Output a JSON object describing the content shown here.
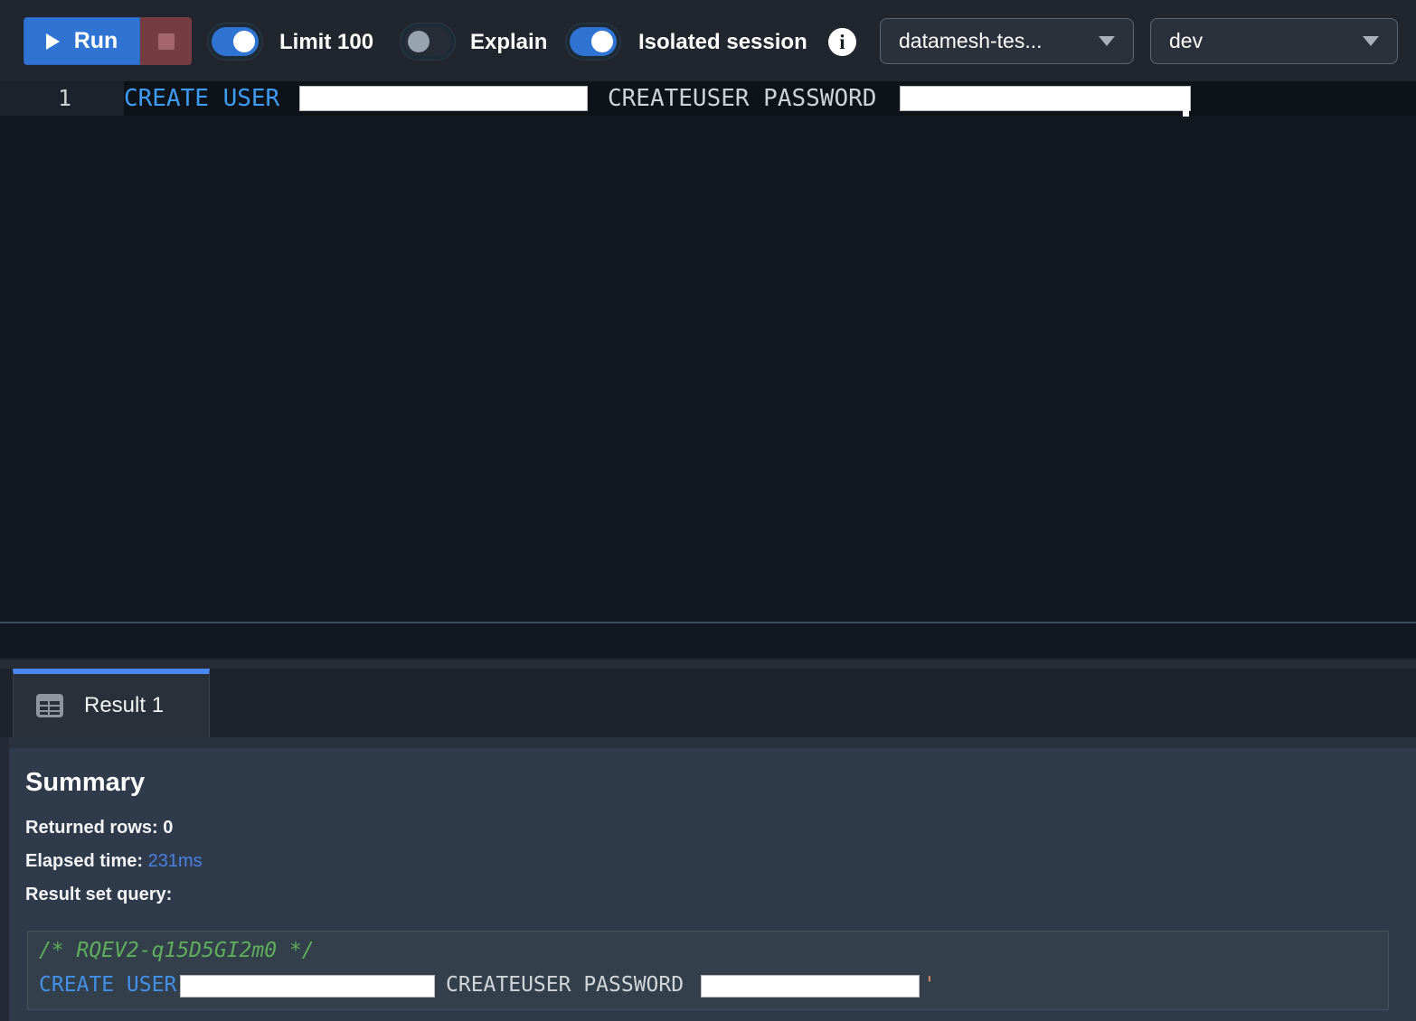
{
  "toolbar": {
    "run_label": "Run",
    "limit_label": "Limit 100",
    "explain_label": "Explain",
    "isolated_label": "Isolated session",
    "cluster_dropdown_value": "datamesh-tes...",
    "database_dropdown_value": "dev",
    "toggles": {
      "limit": true,
      "explain": false,
      "isolated": true
    },
    "info_glyph": "i"
  },
  "editor": {
    "line_number": "1",
    "keyword_create_user": "CREATE USER",
    "keyword_createuser_password": "CREATEUSER PASSWORD"
  },
  "results": {
    "tab_label": "Result 1",
    "summary_title": "Summary",
    "returned_rows_label": "Returned rows: ",
    "returned_rows_value": "0",
    "elapsed_label": "Elapsed time: ",
    "elapsed_value": "231ms",
    "result_set_label": "Result set query:",
    "query_comment": "/* RQEV2-q15D5GI2m0 */",
    "query_keyword_create_user": "CREATE USER",
    "query_keyword_createuser_password": "CREATEUSER PASSWORD",
    "query_closing_quote": "'"
  },
  "colors": {
    "accent-blue": "#2f74d3",
    "tab-blue": "#4b87f2",
    "keyword-blue": "#3d9cf5",
    "keyword-blue-result": "#4390e8",
    "comment-green": "#5fae5c",
    "string-orange": "#cf8a69",
    "elapsed-blue": "#4a80e4"
  }
}
